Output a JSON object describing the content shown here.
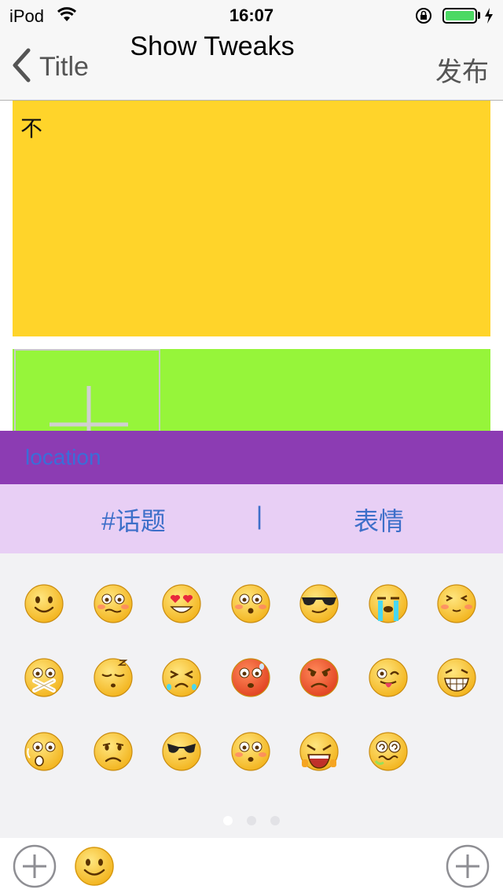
{
  "status_bar": {
    "carrier": "iPod",
    "time": "16:07",
    "battery_level": 1.0
  },
  "nav": {
    "back_label": "Title",
    "title": "Show Tweaks",
    "publish_label": "发布"
  },
  "content": {
    "text_value": "不"
  },
  "location": {
    "label": "location"
  },
  "tabs": {
    "topic_label": "#话题",
    "divider": "|",
    "emoji_label": "表情"
  },
  "emoji_panel": {
    "emojis": [
      "smile",
      "worried",
      "heart-eyes",
      "surprised-blush",
      "cool",
      "crying",
      "blushing",
      "shush",
      "sleepy",
      "sobbing",
      "angry-red",
      "furious",
      "tongue-wink",
      "grin",
      "shocked",
      "sad",
      "sunglasses-smirk",
      "pleading",
      "screaming",
      "dizzy"
    ],
    "page_count": 3,
    "current_page": 1
  },
  "colors": {
    "text_area_bg": "#ffd42a",
    "photo_area_bg": "#96f53a",
    "location_bar_bg": "#8c3cb3",
    "tab_bar_bg": "#e8cff5",
    "link_blue": "#3d6fc9"
  },
  "icons": {
    "back": "chevron-left-icon",
    "add_photo": "plus-icon",
    "toolbar_left": "circle-plus-icon",
    "toolbar_emoji": "smile-icon",
    "toolbar_right": "circle-plus-icon"
  }
}
